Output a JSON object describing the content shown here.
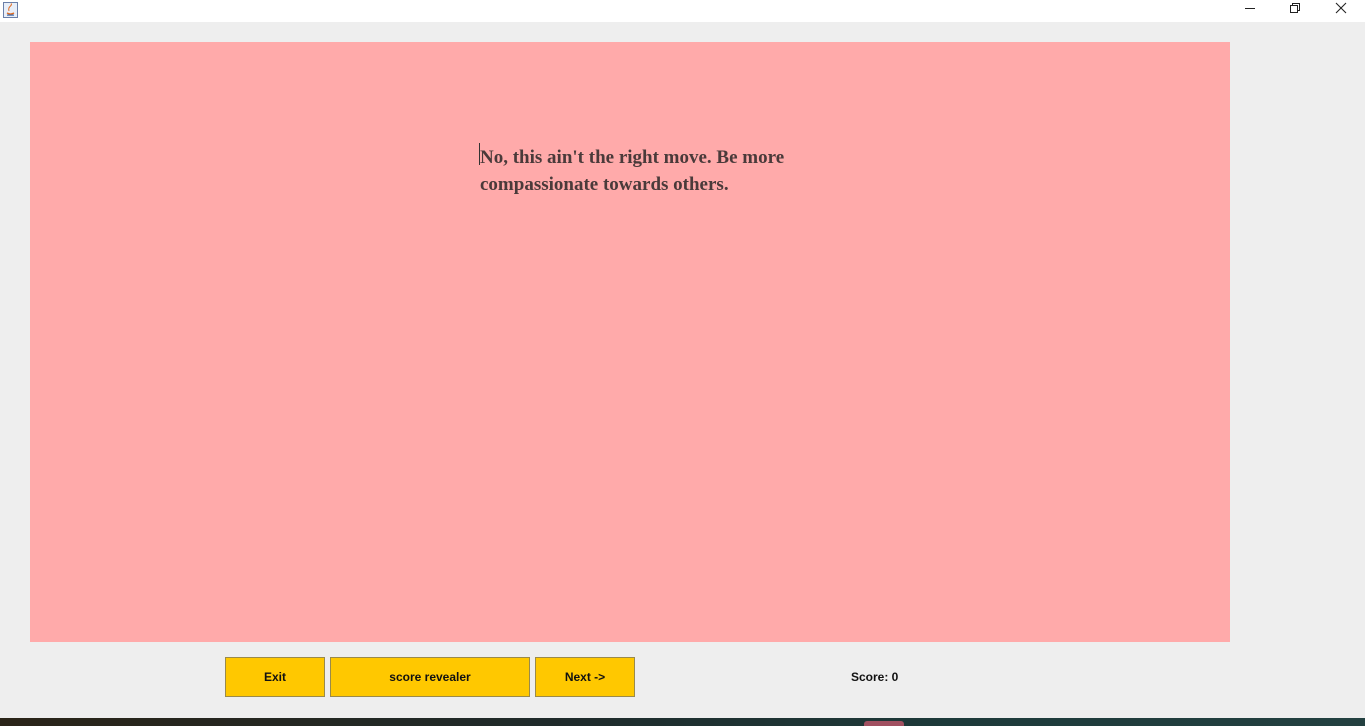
{
  "window": {
    "app_icon": "java-icon",
    "controls": {
      "minimize_icon": "minimize-icon",
      "maximize_icon": "restore-icon",
      "close_icon": "close-icon"
    }
  },
  "content": {
    "background_color": "#ffaaaa",
    "message": "No, this ain't the right move. Be more\ncompassionate towards others."
  },
  "controls": {
    "exit_label": "Exit",
    "score_revealer_label": "score revealer",
    "next_label": "Next ->",
    "button_color": "#ffc800"
  },
  "status": {
    "score_text": "Score: 0"
  }
}
